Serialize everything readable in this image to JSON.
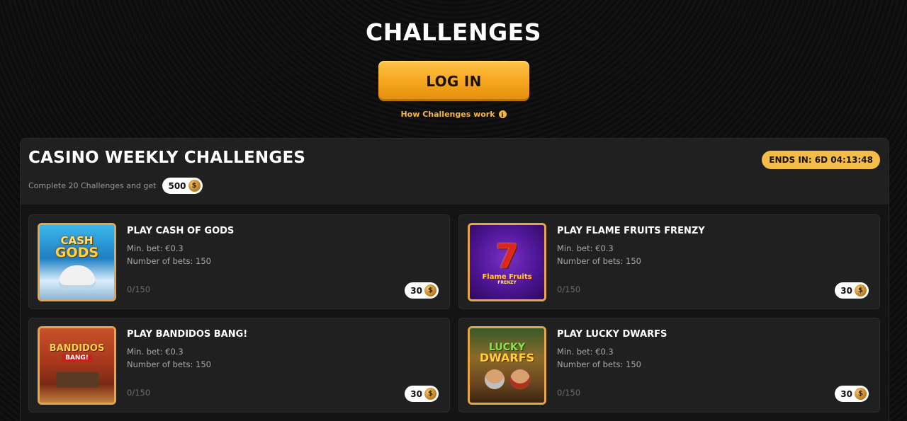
{
  "header": {
    "title": "CHALLENGES",
    "login_label": "LOG IN",
    "how_link": "How Challenges work",
    "info_glyph": "i"
  },
  "panel": {
    "title": "CASINO WEEKLY CHALLENGES",
    "subtitle": "Complete 20 Challenges and get",
    "reward": "500",
    "ends_in": "ENDS IN: 6D 04:13:48"
  },
  "coin_glyph": "$",
  "cards": [
    {
      "title": "PLAY CASH OF GODS",
      "min_bet": "Min. bet: €0.3",
      "num_bets": "Number of bets: 150",
      "progress": "0/150",
      "reward": "30",
      "thumb_logo_line1": "CASH",
      "thumb_logo_line2": "GODS"
    },
    {
      "title": "PLAY FLAME FRUITS FRENZY",
      "min_bet": "Min. bet: €0.3",
      "num_bets": "Number of bets: 150",
      "progress": "0/150",
      "reward": "30",
      "thumb_logo_line1": "Flame Fruits",
      "thumb_logo_line2": "FRENZY"
    },
    {
      "title": "PLAY BANDIDOS BANG!",
      "min_bet": "Min. bet: €0.3",
      "num_bets": "Number of bets: 150",
      "progress": "0/150",
      "reward": "30",
      "thumb_logo_line1": "BANDIDOS",
      "thumb_logo_line2": "BANG!"
    },
    {
      "title": "PLAY LUCKY DWARFS",
      "min_bet": "Min. bet: €0.3",
      "num_bets": "Number of bets: 150",
      "progress": "0/150",
      "reward": "30",
      "thumb_logo_line1": "LUCKY",
      "thumb_logo_line2": "DWARFS"
    }
  ],
  "colors": {
    "accent": "#f3bd47",
    "button": "#f6a51e",
    "card_bg": "#202020",
    "thumb_border": "#e3a64a"
  }
}
